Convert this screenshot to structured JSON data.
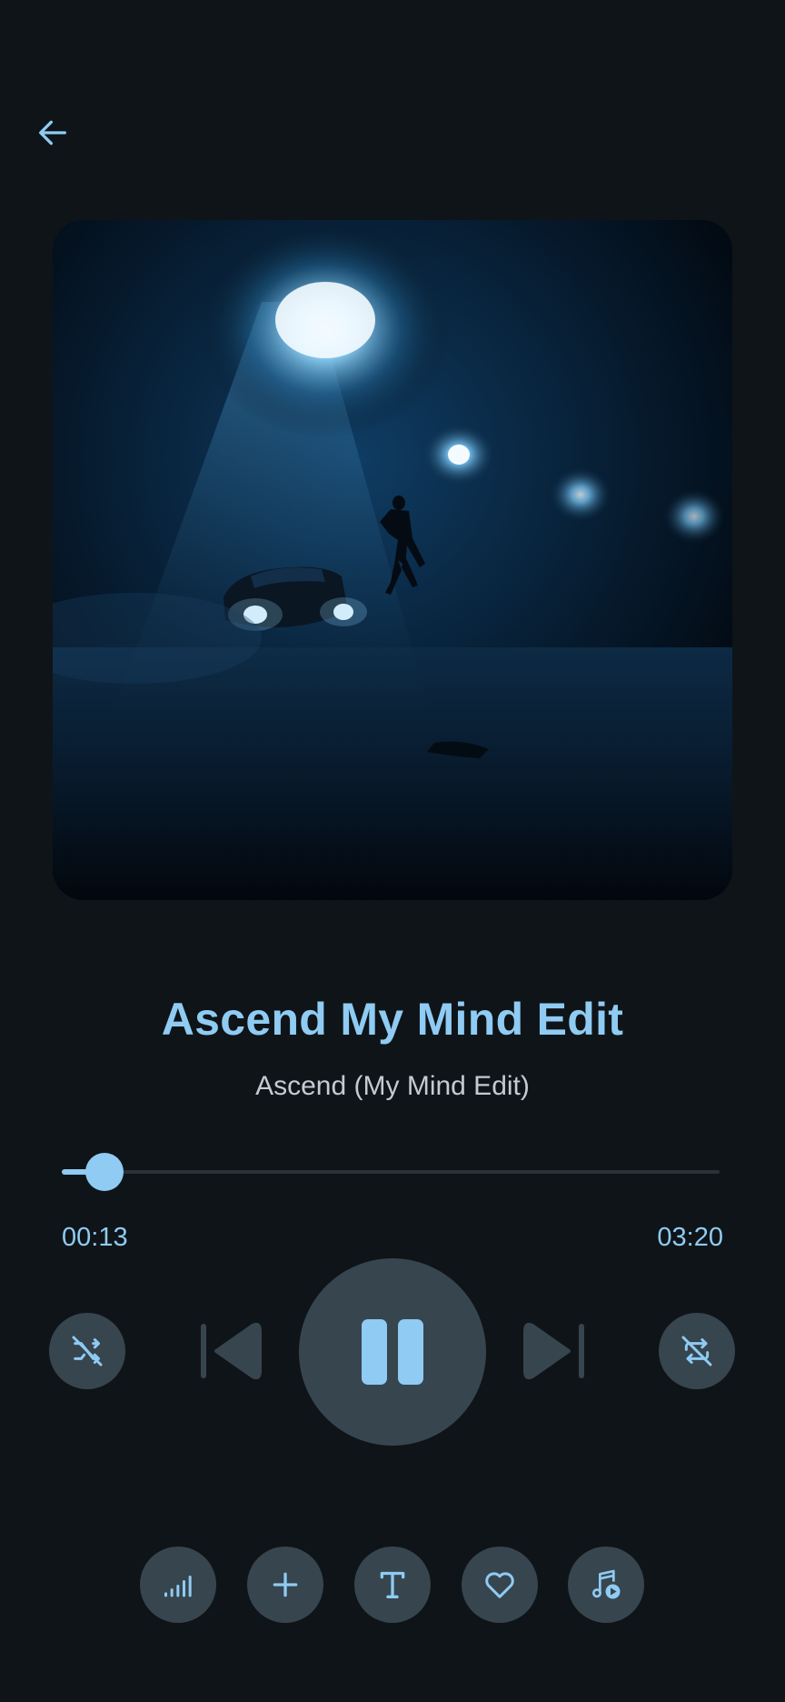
{
  "header": {
    "back_icon": "arrow-left-icon"
  },
  "album_art": {
    "description_icon": "album-cover-image"
  },
  "track": {
    "title": "Ascend My Mind Edit",
    "subtitle": "Ascend (My Mind Edit)"
  },
  "progress": {
    "current": "00:13",
    "total": "03:20",
    "fraction": 0.065
  },
  "controls": {
    "shuffle_icon": "shuffle-off-icon",
    "previous_icon": "skip-previous-icon",
    "play_pause_icon": "pause-icon",
    "next_icon": "skip-next-icon",
    "repeat_icon": "repeat-off-icon"
  },
  "actions": [
    {
      "icon": "equalizer-icon"
    },
    {
      "icon": "add-icon"
    },
    {
      "icon": "lyrics-text-icon"
    },
    {
      "icon": "heart-icon"
    },
    {
      "icon": "playlist-music-icon"
    }
  ],
  "colors": {
    "background": "#0f1418",
    "accent": "#8fcbf2",
    "button_bg": "#37454f",
    "subtitle": "#c3ccd3"
  }
}
